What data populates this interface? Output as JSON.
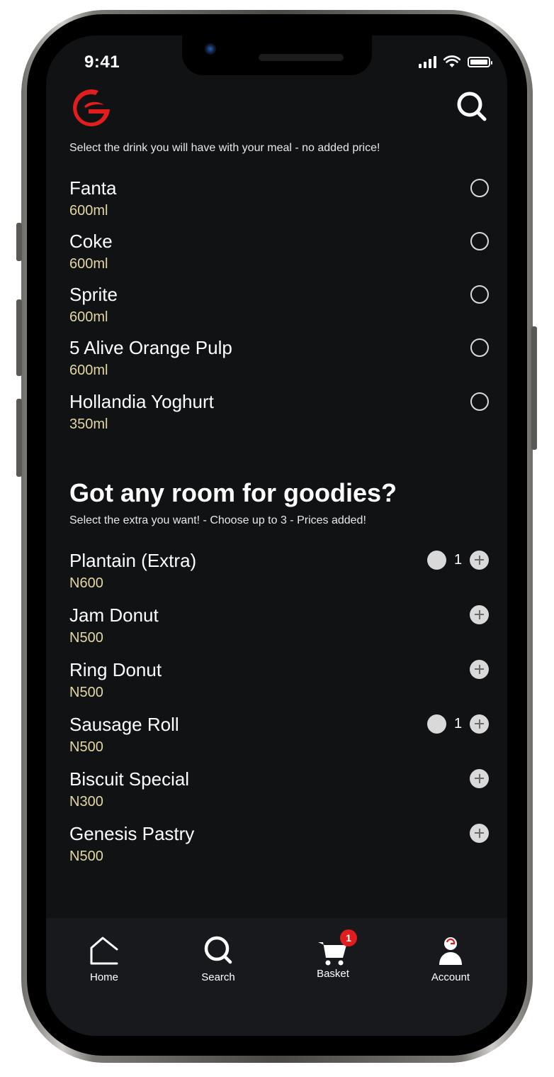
{
  "status_bar": {
    "time": "9:41"
  },
  "header": {
    "logo_icon": "brand-g-logo",
    "search_icon": "search-icon"
  },
  "drinks": {
    "instruction": "Select the drink you will have with your meal - no added price!",
    "items": [
      {
        "name": "Fanta",
        "size": "600ml",
        "selected": false
      },
      {
        "name": "Coke",
        "size": "600ml",
        "selected": false
      },
      {
        "name": "Sprite",
        "size": "600ml",
        "selected": false
      },
      {
        "name": "5 Alive Orange Pulp",
        "size": "600ml",
        "selected": false
      },
      {
        "name": "Hollandia Yoghurt",
        "size": "350ml",
        "selected": false
      }
    ]
  },
  "extras": {
    "title": "Got any room for goodies?",
    "instruction": "Select the extra you want! - Choose up to 3 - Prices added!",
    "items": [
      {
        "name": "Plantain (Extra)",
        "price": "N600",
        "qty": "1"
      },
      {
        "name": "Jam Donut",
        "price": "N500",
        "qty": ""
      },
      {
        "name": "Ring Donut",
        "price": "N500",
        "qty": ""
      },
      {
        "name": "Sausage Roll",
        "price": "N500",
        "qty": "1"
      },
      {
        "name": "Biscuit Special",
        "price": "N300",
        "qty": ""
      },
      {
        "name": "Genesis Pastry",
        "price": "N500",
        "qty": ""
      }
    ]
  },
  "tabbar": {
    "home": "Home",
    "search": "Search",
    "basket": "Basket",
    "basket_badge": "1",
    "account": "Account"
  },
  "colors": {
    "background": "#111214",
    "accent_red": "#e11d1d",
    "subtext_gold": "#e2d6a2",
    "control_grey": "#d9d9d9"
  }
}
